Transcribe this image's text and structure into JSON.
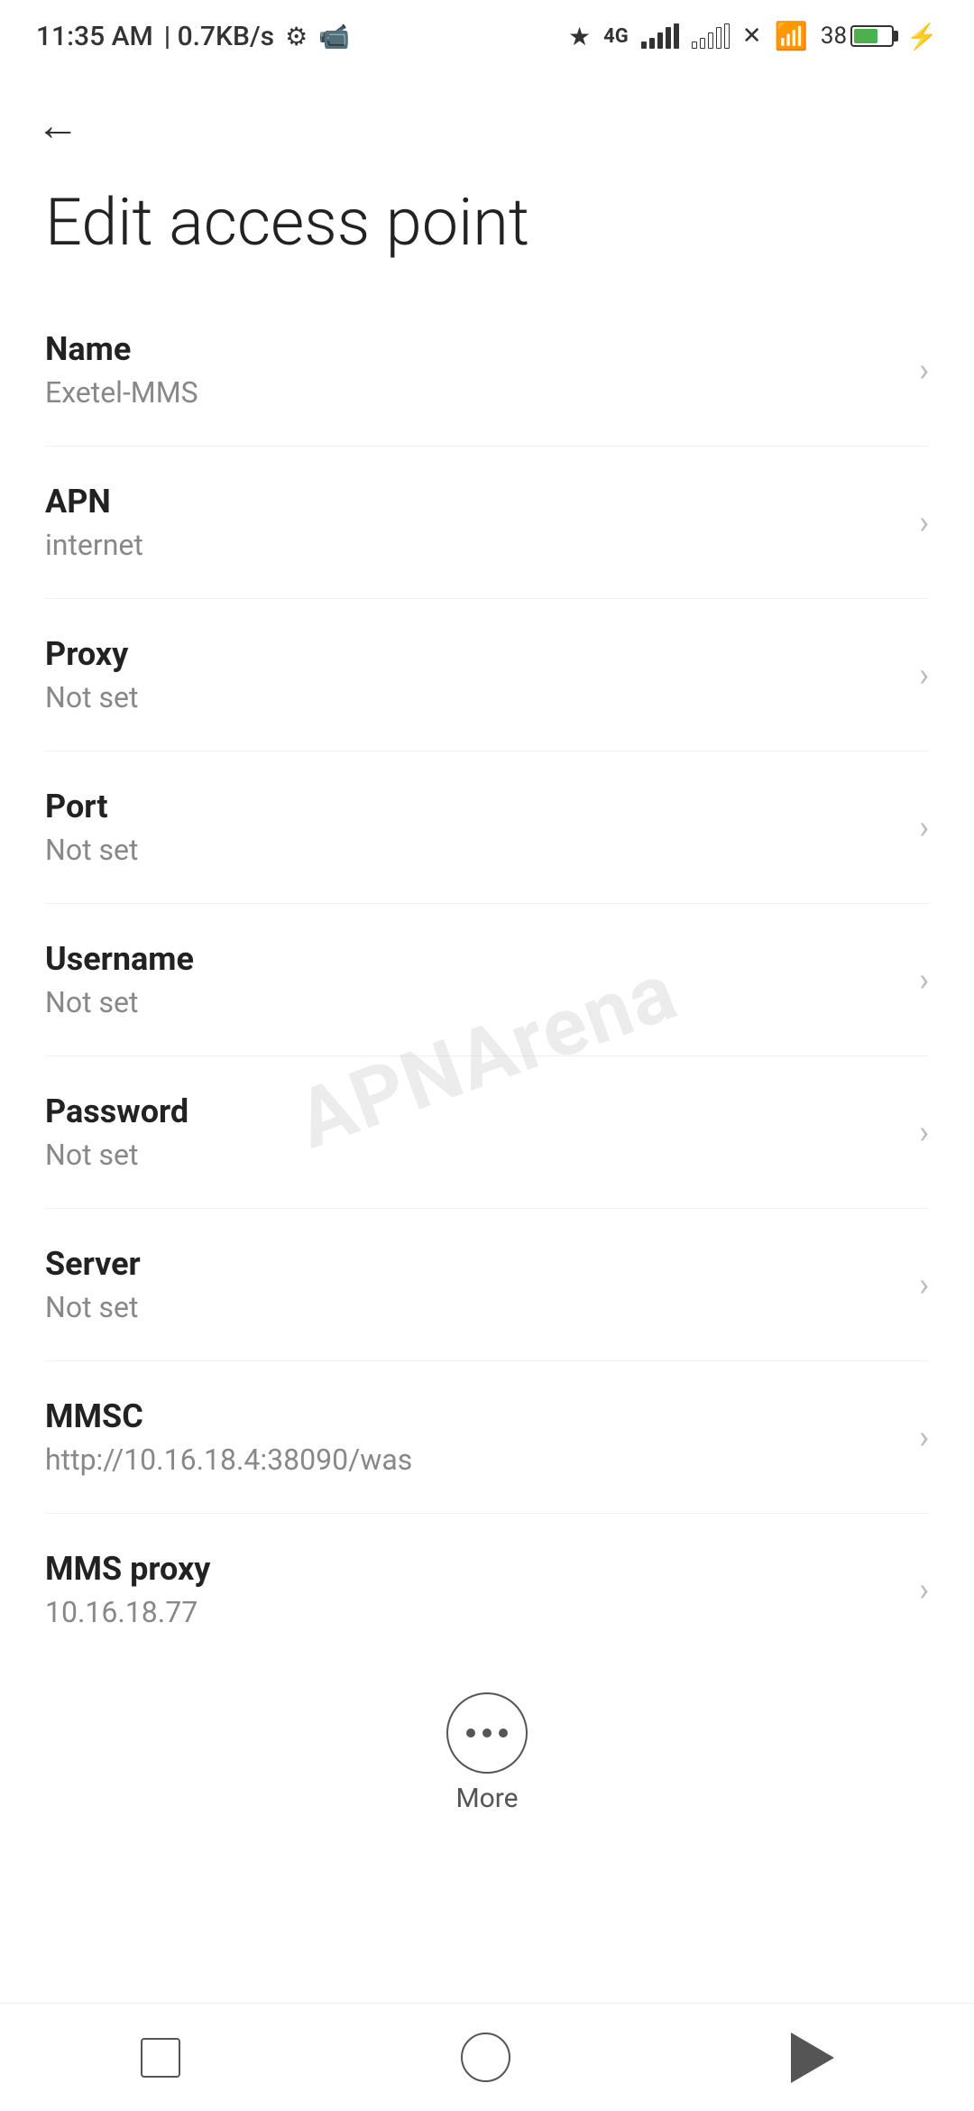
{
  "statusBar": {
    "time": "11:35 AM",
    "speed": "0.7KB/s"
  },
  "header": {
    "backLabel": "←"
  },
  "page": {
    "title": "Edit access point"
  },
  "settings": [
    {
      "label": "Name",
      "value": "Exetel-MMS"
    },
    {
      "label": "APN",
      "value": "internet"
    },
    {
      "label": "Proxy",
      "value": "Not set"
    },
    {
      "label": "Port",
      "value": "Not set"
    },
    {
      "label": "Username",
      "value": "Not set"
    },
    {
      "label": "Password",
      "value": "Not set"
    },
    {
      "label": "Server",
      "value": "Not set"
    },
    {
      "label": "MMSC",
      "value": "http://10.16.18.4:38090/was"
    },
    {
      "label": "MMS proxy",
      "value": "10.16.18.77"
    }
  ],
  "more": {
    "label": "More"
  },
  "watermark": "APNArena"
}
